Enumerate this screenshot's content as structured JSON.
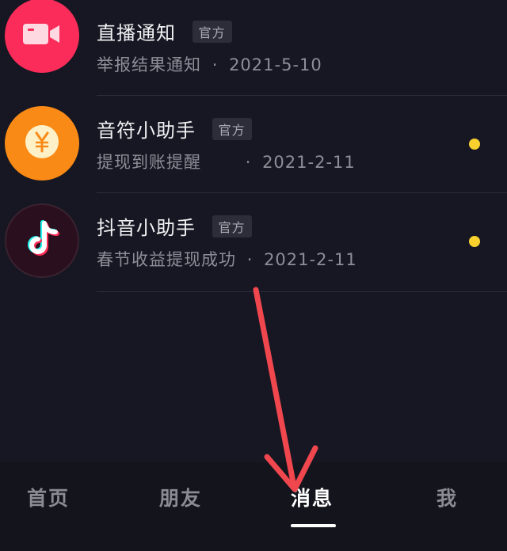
{
  "messages": [
    {
      "title": "直播通知",
      "tag": "官方",
      "subtitle": "举报结果通知",
      "separator": "·",
      "date": "2021-5-10",
      "icon": "video-camera-icon",
      "color": "#fb2c5a",
      "unread": false
    },
    {
      "title": "音符小助手",
      "tag": "官方",
      "subtitle": "提现到账提醒",
      "separator": "·",
      "date": "2021-2-11",
      "icon": "yen-coin-icon",
      "color": "#fa8a16",
      "unread": true
    },
    {
      "title": "抖音小助手",
      "tag": "官方",
      "subtitle": "春节收益提现成功",
      "separator": "·",
      "date": "2021-2-11",
      "icon": "tiktok-logo-icon",
      "color": "#2a0f1e",
      "unread": true
    }
  ],
  "tabs": [
    {
      "label": "首页",
      "active": false
    },
    {
      "label": "朋友",
      "active": false
    },
    {
      "label": "消息",
      "active": true
    },
    {
      "label": "我",
      "active": false
    }
  ],
  "colors": {
    "accent_dot": "#f8d12e",
    "annotation_arrow": "#f0474f"
  }
}
